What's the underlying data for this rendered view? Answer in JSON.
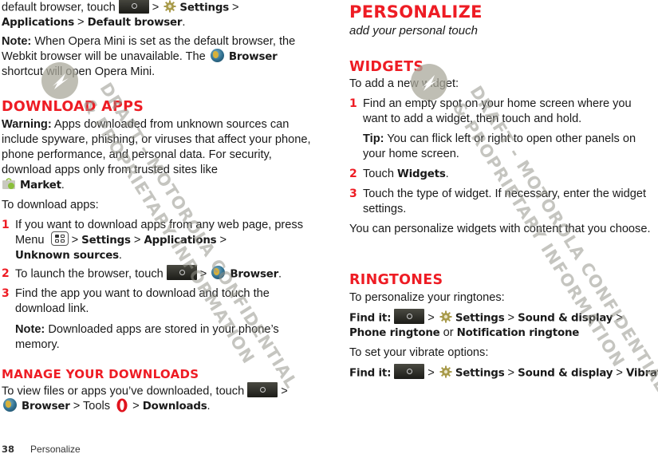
{
  "left": {
    "intro": {
      "line1_pre": "default browser, touch",
      "sep": ">",
      "settings": "Settings",
      "applications": "Applications",
      "default_browser": "Default browser",
      "period": "."
    },
    "note1": {
      "lead": "Note:",
      "text_a": " When Opera Mini is set as the default browser, the Webkit browser will be unavailable. The ",
      "browser": "Browser",
      "text_b": " shortcut will open Opera Mini."
    },
    "download_apps": {
      "heading": "Download apps",
      "warning_lead": "Warning:",
      "warning_text": " Apps downloaded from unknown sources can include spyware, phishing, or viruses that affect your phone, phone performance, and personal data. For security, download apps only from trusted sites like ",
      "market": "Market",
      "intro": "To download apps:",
      "steps": [
        {
          "num": "1",
          "text_a": "If you want to download apps from any web page, press Menu",
          "settings": "Settings",
          "applications": "Applications",
          "unknown_sources": "Unknown sources"
        },
        {
          "num": "2",
          "text_a": "To launch the browser, touch",
          "browser": "Browser"
        },
        {
          "num": "3",
          "text_a": "Find the app you want to download and touch the download link.",
          "note_lead": "Note:",
          "note_text": " Downloaded apps are stored in your phone’s memory."
        }
      ]
    },
    "manage_downloads": {
      "heading": "Manage your downloads",
      "text_a": "To view files or apps you’ve downloaded, touch",
      "browser": "Browser",
      "tools": " > Tools",
      "downloads": "Downloads"
    }
  },
  "right": {
    "title": "Personalize",
    "subtitle": "add your personal touch",
    "widgets": {
      "heading": "Widgets",
      "intro": "To add a new widget:",
      "steps": [
        {
          "num": "1",
          "text": "Find an empty spot on your home screen where you want to add a widget, then touch and hold.",
          "tip_lead": "Tip:",
          "tip_text": " You can flick left or right to open other panels on your home screen."
        },
        {
          "num": "2",
          "text_a": "Touch ",
          "bold": "Widgets"
        },
        {
          "num": "3",
          "text": "Touch the type of widget. If necessary, enter the widget settings."
        }
      ],
      "outro": "You can personalize widgets with content that you choose."
    },
    "ringtones": {
      "heading": "Ringtones",
      "intro": "To personalize your ringtones:",
      "find_it": "Find it:",
      "settings": "Settings",
      "sound_display": "Sound & display",
      "phone_ringtone": "Phone ringtone",
      "or": " or ",
      "notification_ringtone": "Notification ringtone",
      "vibrate_intro": "To set your vibrate options:",
      "vibrate": "Vibrate"
    }
  },
  "footer": {
    "page_number": "38",
    "section": "Personalize"
  },
  "watermark": {
    "line1": "DRAFT - MOTOROLA CONFIDENTIAL",
    "line2": "& PROPRIETARY INFORMATION"
  },
  "icons": {
    "home": "home-key-icon",
    "settings": "settings-gear-icon",
    "browser": "browser-globe-icon",
    "menu": "menu-key-icon",
    "market": "market-bag-icon",
    "opera": "opera-icon"
  },
  "colors": {
    "heading_red": "#ee1c24",
    "text": "#1a1a1a"
  }
}
